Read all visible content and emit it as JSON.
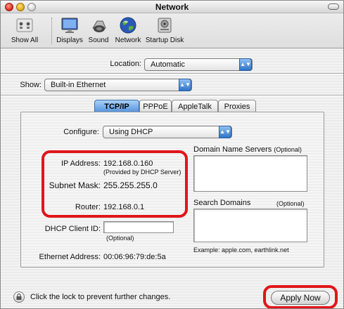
{
  "window": {
    "title": "Network"
  },
  "toolbar": {
    "items": [
      {
        "label": "Show All",
        "icon": "show-all-icon"
      },
      {
        "label": "Displays",
        "icon": "displays-icon"
      },
      {
        "label": "Sound",
        "icon": "sound-icon"
      },
      {
        "label": "Network",
        "icon": "network-globe-icon"
      },
      {
        "label": "Startup Disk",
        "icon": "startup-disk-icon"
      }
    ]
  },
  "location": {
    "label": "Location:",
    "value": "Automatic"
  },
  "show": {
    "label": "Show:",
    "value": "Built-in Ethernet"
  },
  "tabs": [
    "TCP/IP",
    "PPPoE",
    "AppleTalk",
    "Proxies"
  ],
  "tcpip": {
    "configure_label": "Configure:",
    "configure_value": "Using DHCP",
    "ip_label": "IP Address:",
    "ip_value": "192.168.0.160",
    "ip_note": "(Provided by DHCP Server)",
    "subnet_label": "Subnet Mask:",
    "subnet_value": "255.255.255.0",
    "router_label": "Router:",
    "router_value": "192.168.0.1",
    "dhcp_client_label": "DHCP Client ID:",
    "dhcp_client_value": "",
    "dhcp_client_note": "(Optional)",
    "ethernet_label": "Ethernet Address:",
    "ethernet_value": "00:06:96:79:de:5a",
    "dns_label": "Domain Name Servers",
    "dns_optional": "(Optional)",
    "search_domains_label": "Search Domains",
    "search_domains_optional": "(Optional)",
    "example_text": "Example: apple.com, earthlink.net"
  },
  "footer": {
    "lock_text": "Click the lock to prevent further changes.",
    "apply_label": "Apply Now"
  },
  "colors": {
    "highlight_red": "#e0161b",
    "accent_blue": "#2e73c9"
  }
}
